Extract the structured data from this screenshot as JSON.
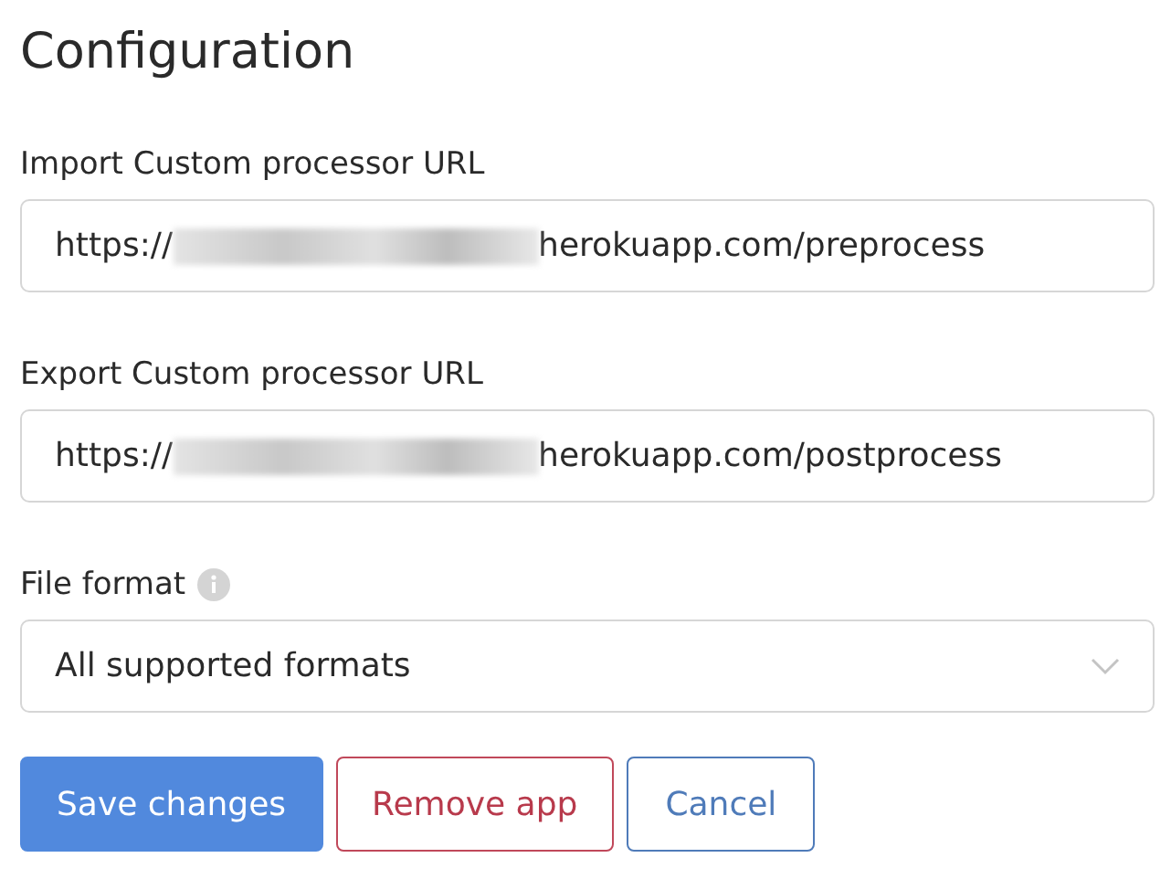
{
  "title": "Configuration",
  "fields": [
    {
      "label": "Import Custom processor URL",
      "value_start": "https://",
      "redacted": true,
      "value_end": "herokuapp.com/preprocess"
    },
    {
      "label": "Export Custom processor URL",
      "value_start": "https://",
      "redacted": true,
      "value_end": "herokuapp.com/postprocess"
    }
  ],
  "file_format": {
    "label": "File format",
    "info": true,
    "value": "All supported formats"
  },
  "buttons": [
    {
      "label": "Save changes",
      "kind": "primary"
    },
    {
      "label": "Remove app",
      "kind": "danger"
    },
    {
      "label": "Cancel",
      "kind": "secondary"
    }
  ]
}
